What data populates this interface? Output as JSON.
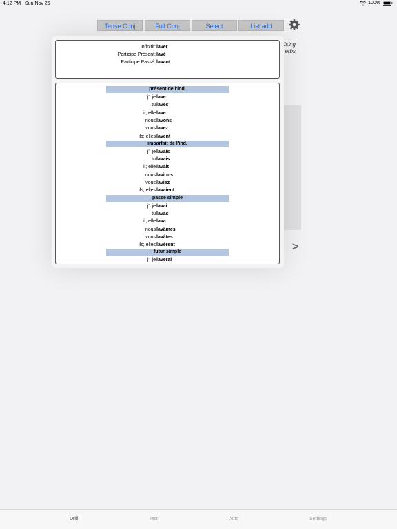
{
  "status_bar": {
    "time": "4:12 PM",
    "date": "Sun Nov 25",
    "battery": "100%"
  },
  "toolbar": {
    "buttons": [
      {
        "label": "Tense Conj"
      },
      {
        "label": "Full Conj"
      },
      {
        "label": "Select"
      },
      {
        "label": "List add"
      }
    ],
    "settings_icon": "gear-icon"
  },
  "background": {
    "hint_line1": "Jsing",
    "hint_line2": "erbs",
    "next_label": ">"
  },
  "info": [
    {
      "label": "Infinitif:",
      "value": "laver"
    },
    {
      "label": "Participe Présent:",
      "value": "lavé"
    },
    {
      "label": "Participe Passé:",
      "value": "lavant"
    }
  ],
  "conjugation": [
    {
      "tense": "présent de l'ind.",
      "rows": [
        {
          "pronoun": "j'; je",
          "form": "lave"
        },
        {
          "pronoun": "tu",
          "form": "laves"
        },
        {
          "pronoun": "il; elle",
          "form": "lave"
        },
        {
          "pronoun": "nous",
          "form": "lavons"
        },
        {
          "pronoun": "vous",
          "form": "lavez"
        },
        {
          "pronoun": "ils; elles",
          "form": "lavent"
        }
      ]
    },
    {
      "tense": "imparfait de l'ind.",
      "rows": [
        {
          "pronoun": "j'; je",
          "form": "lavais"
        },
        {
          "pronoun": "tu",
          "form": "lavais"
        },
        {
          "pronoun": "il; elle",
          "form": "lavait"
        },
        {
          "pronoun": "nous",
          "form": "lavions"
        },
        {
          "pronoun": "vous",
          "form": "laviez"
        },
        {
          "pronoun": "ils; elles",
          "form": "lavaient"
        }
      ]
    },
    {
      "tense": "passé simple",
      "rows": [
        {
          "pronoun": "j'; je",
          "form": "lavai"
        },
        {
          "pronoun": "tu",
          "form": "lavas"
        },
        {
          "pronoun": "il; elle",
          "form": "lava"
        },
        {
          "pronoun": "nous",
          "form": "lavâmes"
        },
        {
          "pronoun": "vous",
          "form": "lavâtes"
        },
        {
          "pronoun": "ils; elles",
          "form": "lavèrent"
        }
      ]
    },
    {
      "tense": "futur simple",
      "rows": [
        {
          "pronoun": "j'; je",
          "form": "laverai"
        }
      ]
    }
  ],
  "tabs": [
    {
      "label": "Drill",
      "active": true
    },
    {
      "label": "Test",
      "active": false
    },
    {
      "label": "Auto",
      "active": false
    },
    {
      "label": "Settings",
      "active": false
    }
  ],
  "colors": {
    "accent": "#2f6fd9",
    "tense_header_bg": "#b3c5df",
    "button_bg": "#c8c8c8"
  }
}
